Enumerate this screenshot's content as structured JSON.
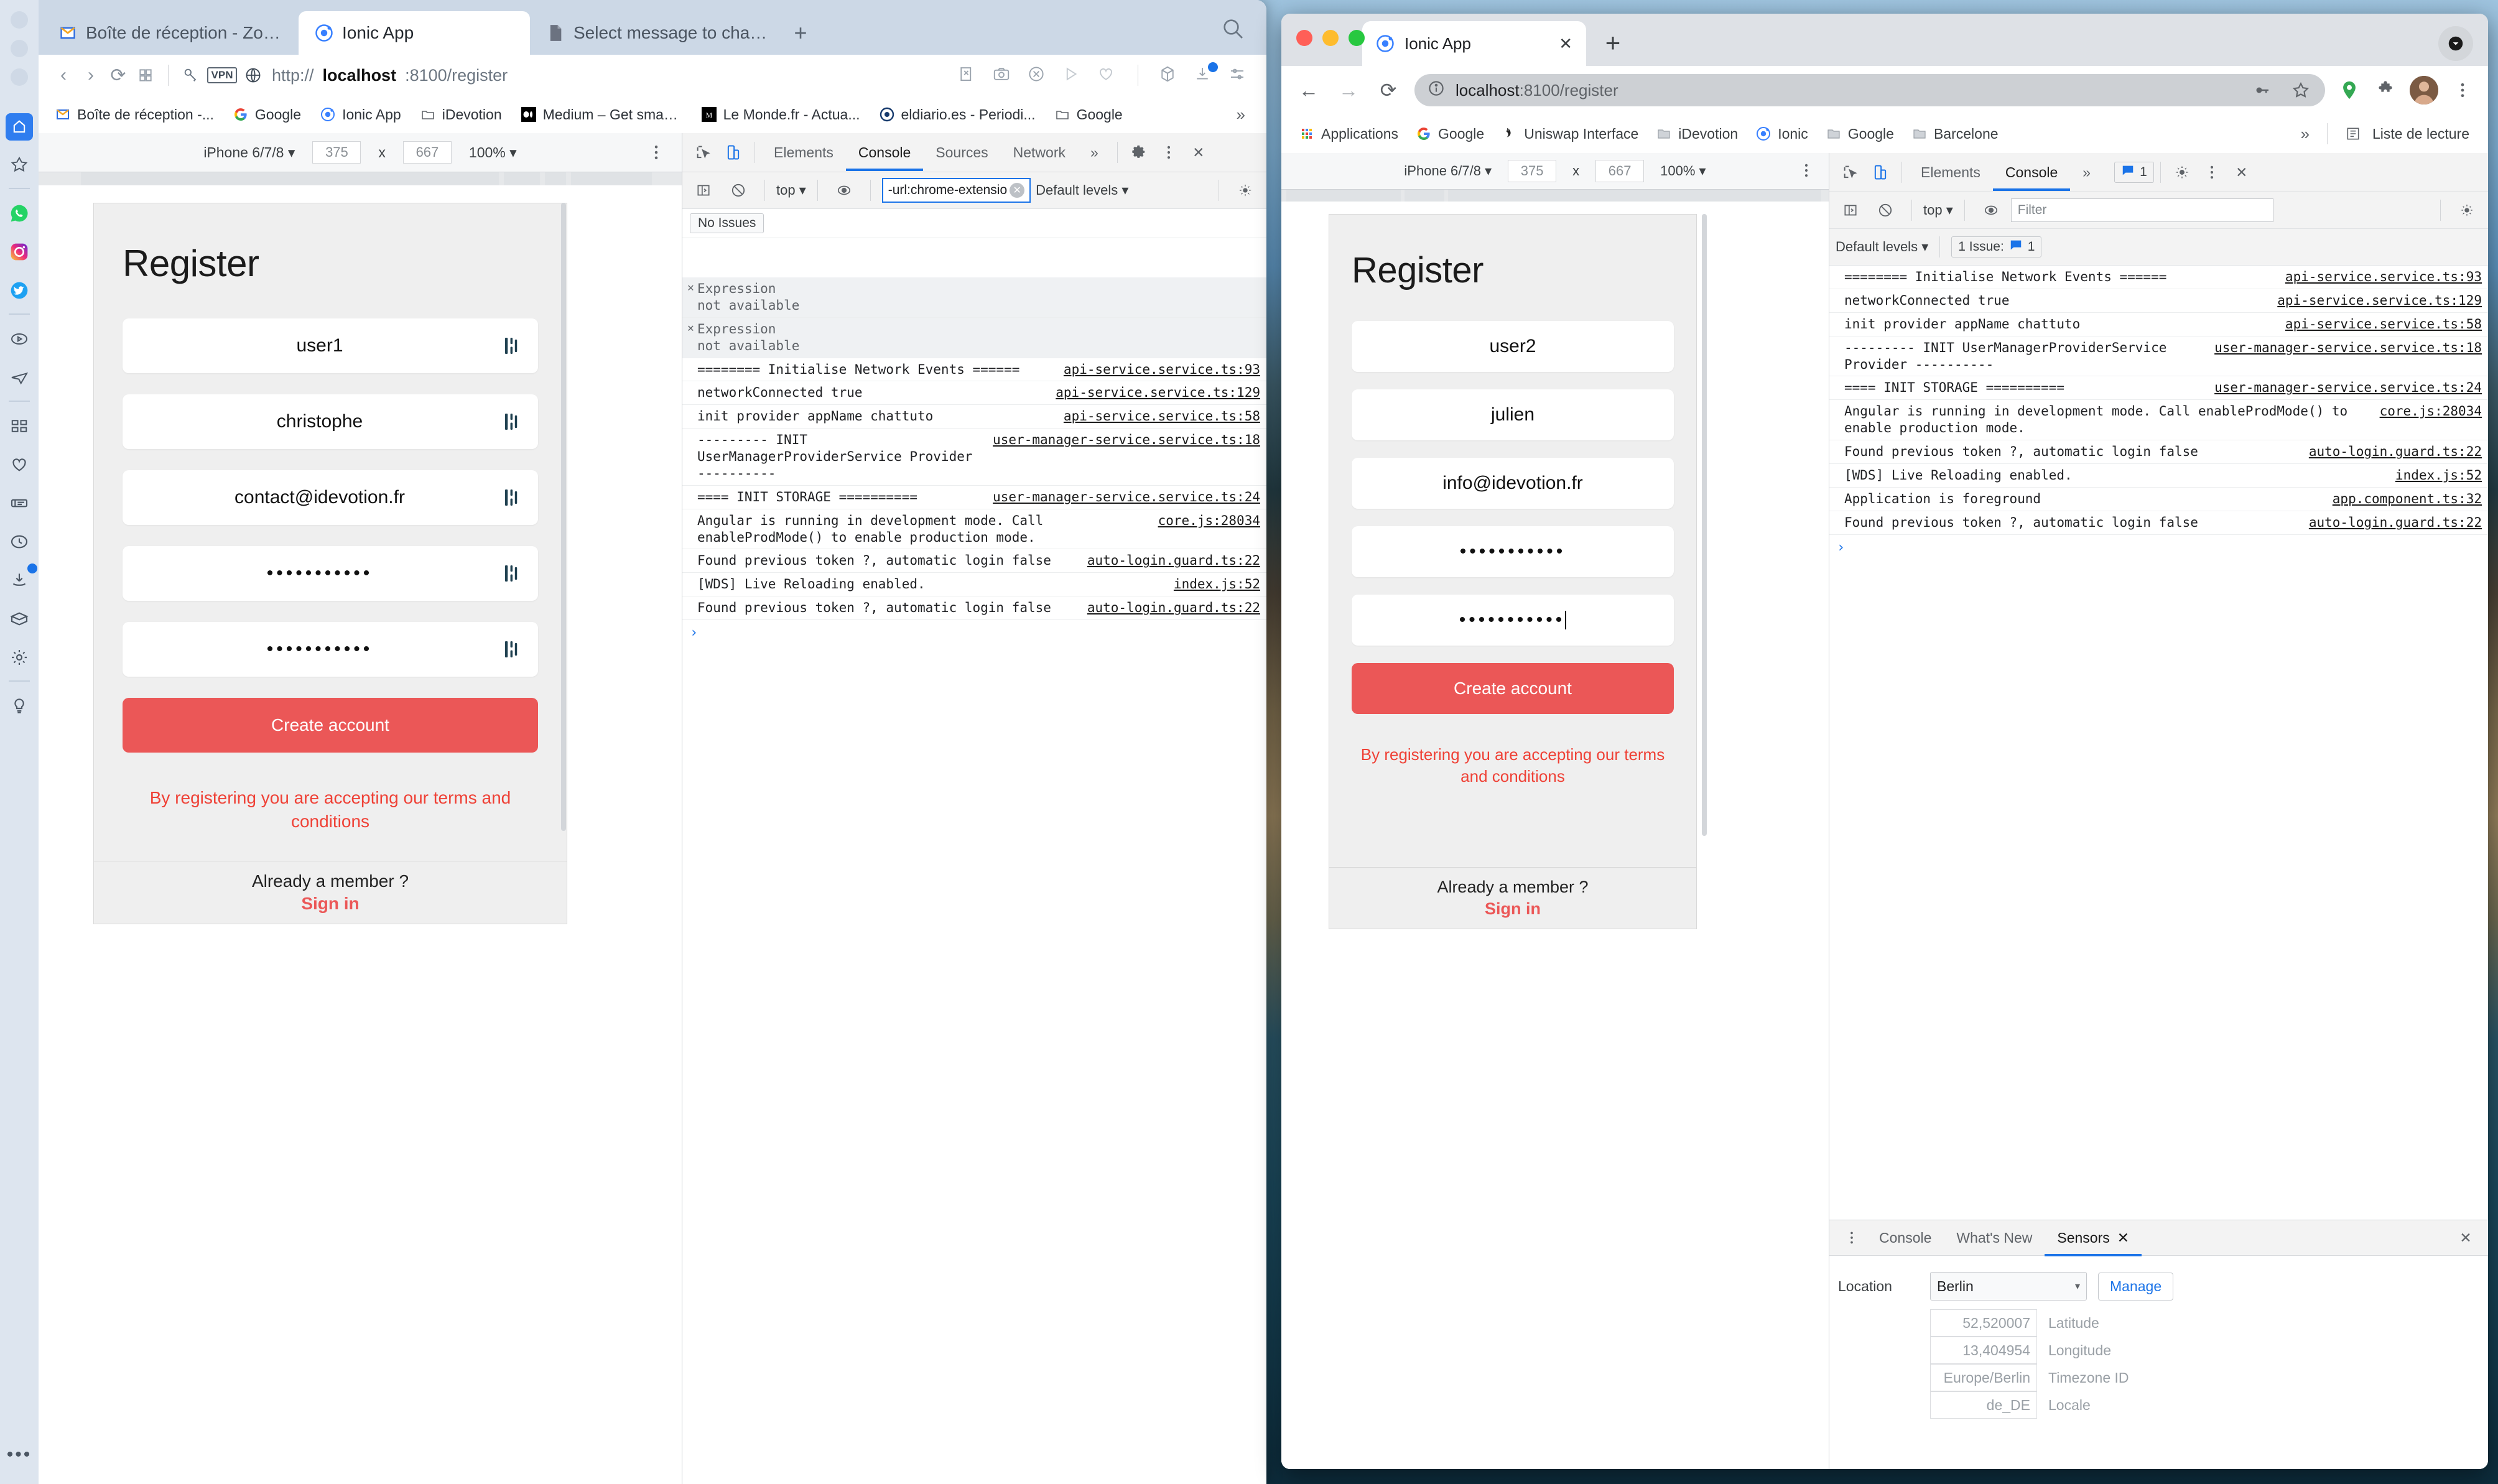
{
  "vivaldi": {
    "tabs": [
      {
        "label": "Boîte de réception - Zoho Mail (",
        "icon": "zoho-mail-icon",
        "active": false
      },
      {
        "label": "Ionic App",
        "icon": "ionic-icon",
        "active": true
      },
      {
        "label": "Select message to change | Dja",
        "icon": "document-icon",
        "active": false
      }
    ],
    "new_tab_label": "+",
    "url": {
      "scheme": "http://",
      "host": "localhost",
      "path": ":8100/register"
    },
    "bookmarks": [
      {
        "label": "Boîte de réception -...",
        "icon": "zoho-mail-icon"
      },
      {
        "label": "Google",
        "icon": "google-icon"
      },
      {
        "label": "Ionic App",
        "icon": "ionic-icon"
      },
      {
        "label": "iDevotion",
        "icon": "folder-icon"
      },
      {
        "label": "Medium – Get smart...",
        "icon": "medium-icon"
      },
      {
        "label": "Le Monde.fr - Actua...",
        "icon": "lemonde-icon"
      },
      {
        "label": "eldiario.es - Periodi...",
        "icon": "eldiario-icon"
      },
      {
        "label": "Google",
        "icon": "folder-icon"
      }
    ],
    "bookmarks_overflow": "»",
    "rail": [
      {
        "name": "panel-toggle-icon"
      },
      {
        "name": "bookmarks-star-icon"
      },
      {
        "name": "whatsapp-icon"
      },
      {
        "name": "instagram-icon"
      },
      {
        "name": "twitter-icon"
      },
      {
        "name": "video-player-icon"
      },
      {
        "name": "telegram-icon"
      },
      {
        "name": "tiles-icon"
      },
      {
        "name": "heart-icon"
      },
      {
        "name": "notes-icon"
      },
      {
        "name": "history-clock-icon"
      },
      {
        "name": "downloads-icon"
      },
      {
        "name": "package-icon"
      },
      {
        "name": "gear-icon"
      },
      {
        "name": "lightbulb-icon"
      },
      {
        "name": "more-dots-icon"
      }
    ],
    "device_toolbar": {
      "device": "iPhone 6/7/8",
      "width": "375",
      "x_label": "x",
      "height": "667",
      "zoom": "100%"
    },
    "devtools": {
      "tabs": [
        "Elements",
        "Console",
        "Sources",
        "Network"
      ],
      "selected_tab": "Console",
      "overflow": "»",
      "context": "top",
      "filter_value": "-url:chrome-extensio",
      "levels": "Default levels",
      "issues_label": "No Issues",
      "console_rows": [
        {
          "kind": "warn",
          "message": "Expression\nnot available",
          "source": ""
        },
        {
          "kind": "warn",
          "message": "Expression\nnot available",
          "source": ""
        },
        {
          "kind": "log",
          "message": "======== Initialise Network Events ======",
          "source": "api-service.service.ts:93"
        },
        {
          "kind": "log",
          "message": "networkConnected true",
          "source": "api-service.service.ts:129"
        },
        {
          "kind": "log",
          "message": "init provider appName chattuto",
          "source": "api-service.service.ts:58"
        },
        {
          "kind": "log",
          "message": "--------- INIT UserManagerProviderService Provider ----------",
          "source": "user-manager-service.service.ts:18"
        },
        {
          "kind": "log",
          "message": "==== INIT STORAGE ==========",
          "source": "user-manager-service.service.ts:24"
        },
        {
          "kind": "log",
          "message": "Angular is running in development mode. Call enableProdMode() to enable production mode.",
          "source": "core.js:28034"
        },
        {
          "kind": "log",
          "message": "Found previous token ?, automatic login false",
          "source": "auto-login.guard.ts:22"
        },
        {
          "kind": "log",
          "message": "[WDS] Live Reloading enabled.",
          "source": "index.js:52"
        },
        {
          "kind": "log",
          "message": "Found previous token ?, automatic login false",
          "source": "auto-login.guard.ts:22"
        }
      ],
      "prompt": "›"
    },
    "app": {
      "title": "Register",
      "fields": [
        {
          "name": "username-field",
          "value": "user1",
          "type": "text",
          "has_icon": true
        },
        {
          "name": "firstname-field",
          "value": "christophe",
          "type": "text",
          "has_icon": true
        },
        {
          "name": "email-field",
          "value": "contact@idevotion.fr",
          "type": "text",
          "has_icon": true
        },
        {
          "name": "password-field",
          "value": "•••••••••••",
          "type": "password",
          "has_icon": true
        },
        {
          "name": "confirm-password-field",
          "value": "•••••••••••",
          "type": "password",
          "has_icon": true
        }
      ],
      "submit_label": "Create account",
      "terms": "By registering you are accepting our terms and conditions",
      "footer_question": "Already a member ?",
      "footer_link": "Sign in"
    }
  },
  "chrome": {
    "tab": {
      "label": "Ionic App",
      "icon": "ionic-icon",
      "close": "✕"
    },
    "new_tab": "+",
    "url": {
      "host": "localhost",
      "path": ":8100/register"
    },
    "bookmarks": [
      {
        "label": "Applications",
        "icon": "apps-grid-icon"
      },
      {
        "label": "Google",
        "icon": "google-icon"
      },
      {
        "label": "Uniswap Interface",
        "icon": "uniswap-icon"
      },
      {
        "label": "iDevotion",
        "icon": "folder-icon"
      },
      {
        "label": "Ionic",
        "icon": "ionic-icon"
      },
      {
        "label": "Google",
        "icon": "folder-icon"
      },
      {
        "label": "Barcelone",
        "icon": "folder-icon"
      }
    ],
    "bookmarks_overflow": "»",
    "reading_list": "Liste de lecture",
    "device_toolbar": {
      "device": "iPhone 6/7/8",
      "width": "375",
      "x_label": "x",
      "height": "667",
      "zoom": "100%"
    },
    "devtools": {
      "tabs": [
        "Elements",
        "Console"
      ],
      "selected_tab": "Console",
      "overflow": "»",
      "issue_count": "1",
      "context": "top",
      "filter_placeholder": "Filter",
      "levels": "Default levels",
      "issues_label": "1 Issue:",
      "issues_count": "1",
      "console_rows": [
        {
          "message": "======== Initialise Network Events ======",
          "source": "api-service.service.ts:93"
        },
        {
          "message": "networkConnected true",
          "source": "api-service.service.ts:129"
        },
        {
          "message": "init provider appName chattuto",
          "source": "api-service.service.ts:58"
        },
        {
          "message": "--------- INIT UserManagerProviderService Provider ----------",
          "source": "user-manager-service.service.ts:18"
        },
        {
          "message": "==== INIT STORAGE ==========",
          "source": "user-manager-service.service.ts:24"
        },
        {
          "message": "Angular is running in development mode. Call enableProdMode() to enable production mode.",
          "source": "core.js:28034"
        },
        {
          "message": "Found previous token ?, automatic login false",
          "source": "auto-login.guard.ts:22"
        },
        {
          "message": "[WDS] Live Reloading enabled.",
          "source": "index.js:52"
        },
        {
          "message": "Application is foreground",
          "source": "app.component.ts:32"
        },
        {
          "message": "Found previous token ?, automatic login false",
          "source": "auto-login.guard.ts:22"
        }
      ],
      "prompt": "›"
    },
    "drawer": {
      "tabs": [
        "Console",
        "What's New",
        "Sensors"
      ],
      "selected_tab": "Sensors",
      "tab_close": "✕",
      "drawer_close": "✕",
      "sensors": {
        "location_label": "Location",
        "location_value": "Berlin",
        "manage_label": "Manage",
        "rows": [
          {
            "value": "52,520007",
            "label": "Latitude"
          },
          {
            "value": "13,404954",
            "label": "Longitude"
          },
          {
            "value": "Europe/Berlin",
            "label": "Timezone ID"
          },
          {
            "value": "de_DE",
            "label": "Locale"
          }
        ]
      }
    },
    "app": {
      "title": "Register",
      "fields": [
        {
          "name": "username-field",
          "value": "user2",
          "type": "text",
          "has_icon": false
        },
        {
          "name": "firstname-field",
          "value": "julien",
          "type": "text",
          "has_icon": false
        },
        {
          "name": "email-field",
          "value": "info@idevotion.fr",
          "type": "text",
          "has_icon": false
        },
        {
          "name": "password-field",
          "value": "•••••••••••",
          "type": "password",
          "has_icon": false
        },
        {
          "name": "confirm-password-field",
          "value": "•••••••••••",
          "type": "password",
          "has_icon": false,
          "focused": true
        }
      ],
      "submit_label": "Create account",
      "terms": "By registering you are accepting our terms and conditions",
      "footer_question": "Already a member ?",
      "footer_link": "Sign in"
    }
  },
  "colors": {
    "accent_red": "#eb5757",
    "terms_red": "#ef4136",
    "devtools_blue": "#1a73e8",
    "ionic_blue": "#3880ff"
  }
}
